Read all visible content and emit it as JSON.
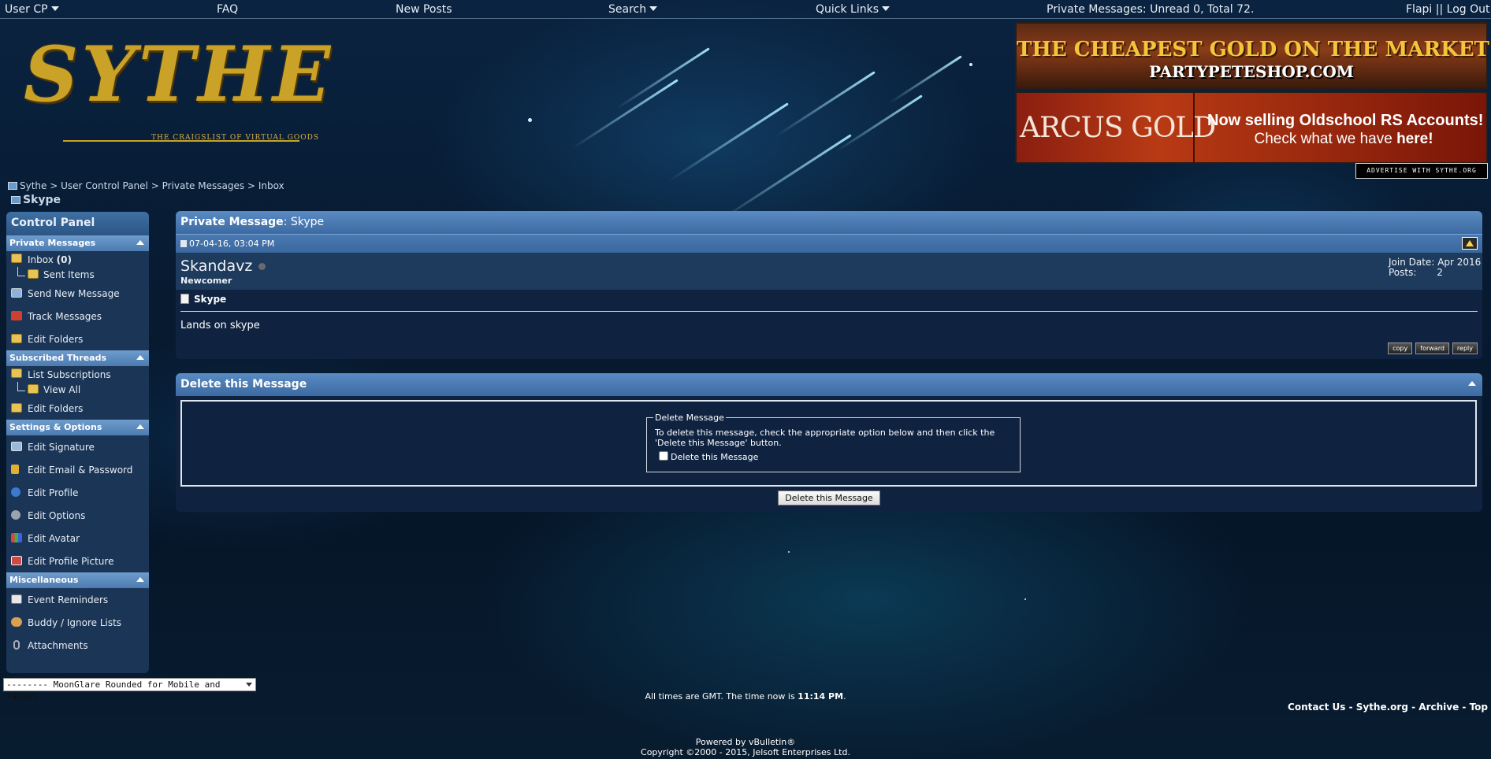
{
  "topnav": {
    "user_cp": "User CP",
    "faq": "FAQ",
    "new_posts": "New Posts",
    "search": "Search",
    "quick_links": "Quick Links",
    "private_messages": "Private Messages: Unread 0, Total 72.",
    "user": "Flapi",
    "separator": "||",
    "logout": "Log Out"
  },
  "logo": {
    "text": "SYTHE",
    "tagline": "THE CRAIGSLIST OF VIRTUAL GOODS"
  },
  "ads": {
    "ad1_line1": "THE CHEAPEST GOLD ON THE MARKET",
    "ad1_line2": "PARTYPETESHOP.COM",
    "ad2_logo": "ARCUS GOLD",
    "ad2_line1": "Now selling Oldschool RS Accounts!",
    "ad2_line2_a": "Check what we have ",
    "ad2_line2_b": "here!",
    "advertise": "ADVERTISE WITH SYTHE.ORG"
  },
  "breadcrumb": {
    "items": [
      "Sythe",
      "User Control Panel",
      "Private Messages",
      "Inbox"
    ],
    "sep": ">",
    "current": "Skype"
  },
  "sidebar": {
    "title": "Control Panel",
    "sections": [
      {
        "title": "Private Messages"
      },
      {
        "title": "Subscribed Threads"
      },
      {
        "title": "Settings & Options"
      },
      {
        "title": "Miscellaneous"
      }
    ],
    "pm_items": {
      "inbox": "Inbox",
      "inbox_count": "(0)",
      "sent": "Sent Items",
      "send_new": "Send New Message",
      "track": "Track Messages",
      "edit_folders": "Edit Folders"
    },
    "sub_items": {
      "list": "List Subscriptions",
      "view_all": "View All",
      "edit_folders": "Edit Folders"
    },
    "settings_items": {
      "signature": "Edit Signature",
      "email": "Edit Email & Password",
      "profile": "Edit Profile",
      "options": "Edit Options",
      "avatar": "Edit Avatar",
      "profile_picture": "Edit Profile Picture"
    },
    "misc_items": {
      "reminders": "Event Reminders",
      "buddy": "Buddy / Ignore Lists",
      "attachments": "Attachments"
    }
  },
  "pm": {
    "header_label": "Private Message",
    "header_title": "Skype",
    "date": "07-04-16, 03:04 PM",
    "username": "Skandavz",
    "user_title": "Newcomer",
    "join_label": "Join Date:",
    "join_value": "Apr 2016",
    "posts_label": "Posts:",
    "posts_value": "2",
    "subject": "Skype",
    "message": "Lands on skype",
    "buttons": {
      "copy": "copy",
      "forward": "forward",
      "reply": "reply"
    }
  },
  "delete": {
    "title": "Delete this Message",
    "legend": "Delete Message",
    "instructions": "To delete this message, check the appropriate option below and then click the 'Delete this Message' button.",
    "checkbox_label": "Delete this Message",
    "checked": false,
    "button": "Delete this Message"
  },
  "footer": {
    "style_select": "-------- MoonGlare Rounded for Mobile and Tablet",
    "time_prefix": "All times are GMT. The time now is ",
    "time_value": "11:14 PM",
    "time_suffix": ".",
    "links": [
      "Contact Us",
      "Sythe.org",
      "Archive",
      "Top"
    ],
    "link_sep": " - ",
    "powered": "Powered by vBulletin®",
    "copyright": "Copyright ©2000 - 2015, Jelsoft Enterprises Ltd."
  },
  "colors": {
    "panel_header": "#4a7ab3",
    "panel_bg": "#0f2340",
    "sidebar_bg": "#1b3556",
    "logo_gold": "#c9a227"
  }
}
